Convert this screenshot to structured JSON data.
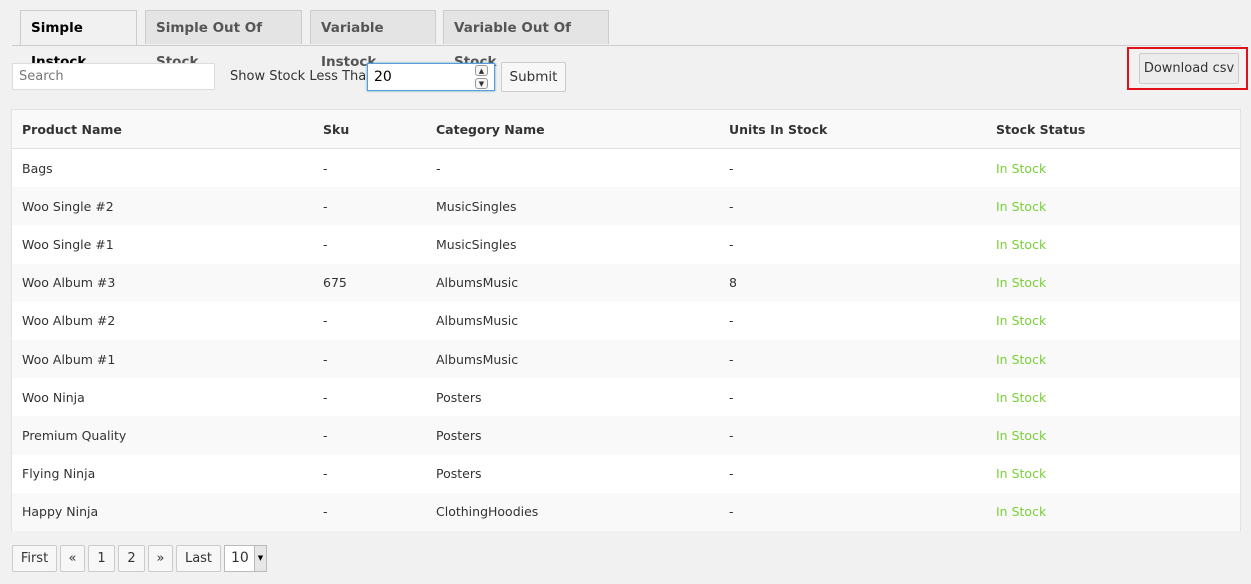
{
  "tabs": [
    {
      "label": "Simple Instock",
      "active": true
    },
    {
      "label": "Simple Out Of Stock",
      "active": false
    },
    {
      "label": "Variable Instock",
      "active": false
    },
    {
      "label": "Variable Out Of Stock",
      "active": false
    }
  ],
  "filters": {
    "search_placeholder": "Search",
    "search_value": "",
    "stock_label": "Show Stock Less Than",
    "stock_value": "20",
    "submit_label": "Submit",
    "download_label": "Download csv",
    "spin_up": "▲",
    "spin_down": "▼"
  },
  "table": {
    "columns": [
      "Product Name",
      "Sku",
      "Category Name",
      "Units In Stock",
      "Stock Status"
    ],
    "rows": [
      [
        "Bags",
        "-",
        "-",
        "-",
        "In Stock"
      ],
      [
        "Woo Single #2",
        "-",
        "MusicSingles",
        "-",
        "In Stock"
      ],
      [
        "Woo Single #1",
        "-",
        "MusicSingles",
        "-",
        "In Stock"
      ],
      [
        "Woo Album #3",
        "675",
        "AlbumsMusic",
        "8",
        "In Stock"
      ],
      [
        "Woo Album #2",
        "-",
        "AlbumsMusic",
        "-",
        "In Stock"
      ],
      [
        "Woo Album #1",
        "-",
        "AlbumsMusic",
        "-",
        "In Stock"
      ],
      [
        "Woo Ninja",
        "-",
        "Posters",
        "-",
        "In Stock"
      ],
      [
        "Premium Quality",
        "-",
        "Posters",
        "-",
        "In Stock"
      ],
      [
        "Flying Ninja",
        "-",
        "Posters",
        "-",
        "In Stock"
      ],
      [
        "Happy Ninja",
        "-",
        "ClothingHoodies",
        "-",
        "In Stock"
      ]
    ]
  },
  "pagination": {
    "first": "First",
    "prev": "«",
    "pages": [
      "1",
      "2"
    ],
    "next": "»",
    "last": "Last",
    "page_size": "10",
    "dropdown_arrow": "▼"
  },
  "colors": {
    "in_stock": "#7ad03a",
    "highlight": "#e3101a",
    "focus": "#5b9dd9"
  }
}
